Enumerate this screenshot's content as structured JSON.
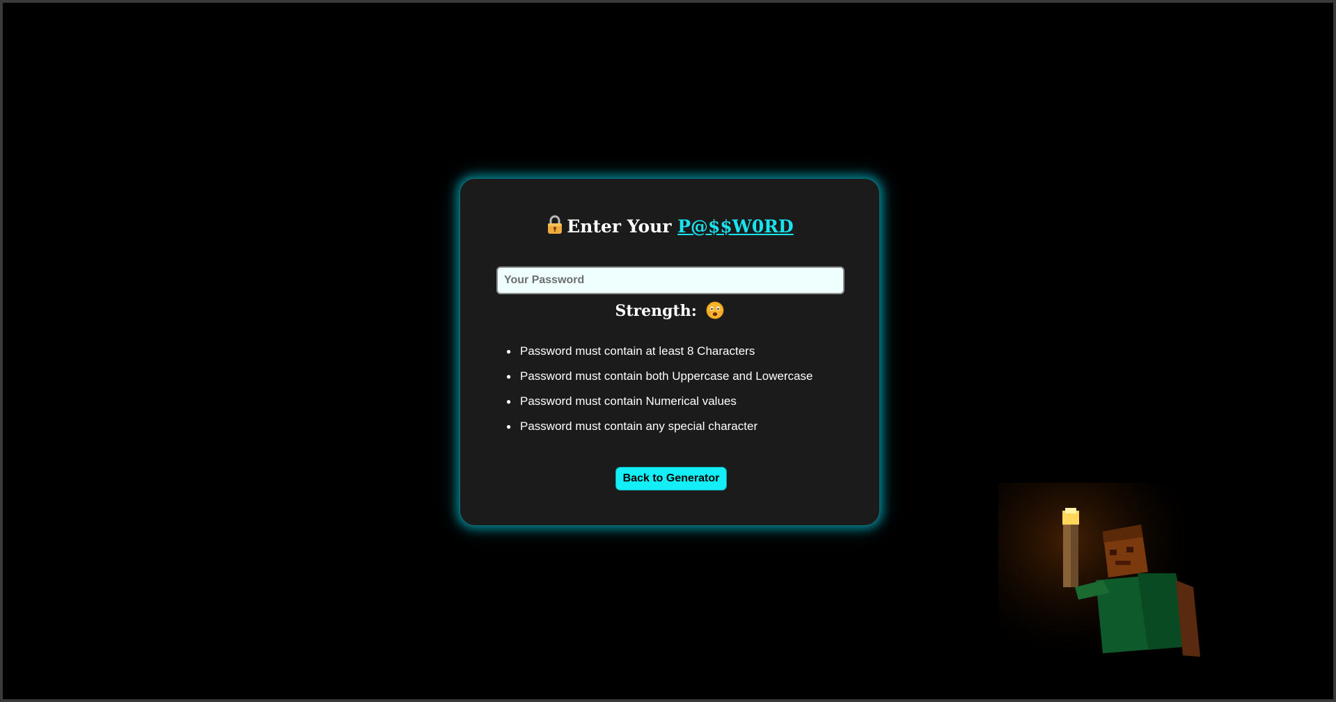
{
  "card": {
    "title_prefix": "Enter Your ",
    "title_accent": "P@$$W0RD",
    "lock_icon": "lock-icon",
    "password_placeholder": "Your Password",
    "password_value": "",
    "strength_label": "Strength:",
    "strength_icon": "worried-face-icon",
    "rules": [
      "Password must contain at least 8 Characters",
      "Password must contain both Uppercase and Lowercase",
      "Password must contain Numerical values",
      "Password must contain any special character"
    ],
    "back_button_label": "Back to Generator"
  },
  "colors": {
    "background": "#000000",
    "card": "#1b1b1b",
    "accent": "#19e3ef",
    "button": "#14eef6",
    "input_bg": "#eefffe"
  },
  "decoration": "minecraft-character-with-torch"
}
